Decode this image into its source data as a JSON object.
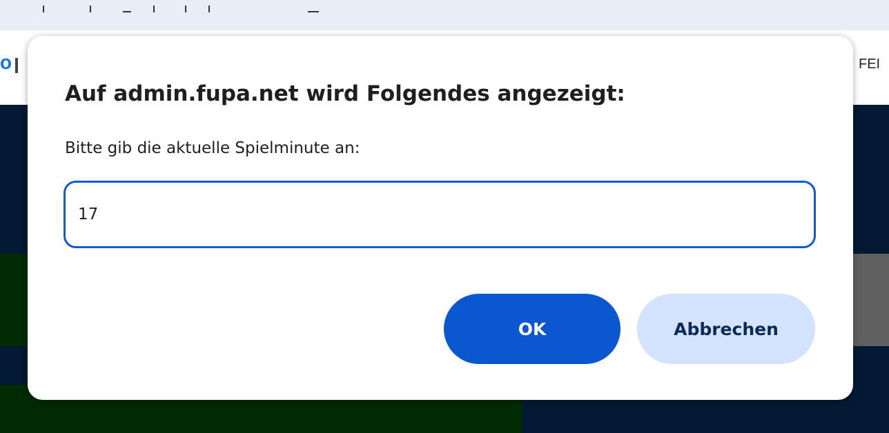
{
  "background": {
    "header_right_text": "FEI"
  },
  "dialog": {
    "title": "Auf admin.fupa.net wird Folgendes angezeigt:",
    "message": "Bitte gib die aktuelle Spielminute an:",
    "input_value": "17",
    "ok_label": "OK",
    "cancel_label": "Abbrechen"
  },
  "colors": {
    "primary_button": "#0b57d0",
    "secondary_button": "#d3e3fd",
    "input_border": "#1457d2",
    "page_dark": "#021a33"
  }
}
